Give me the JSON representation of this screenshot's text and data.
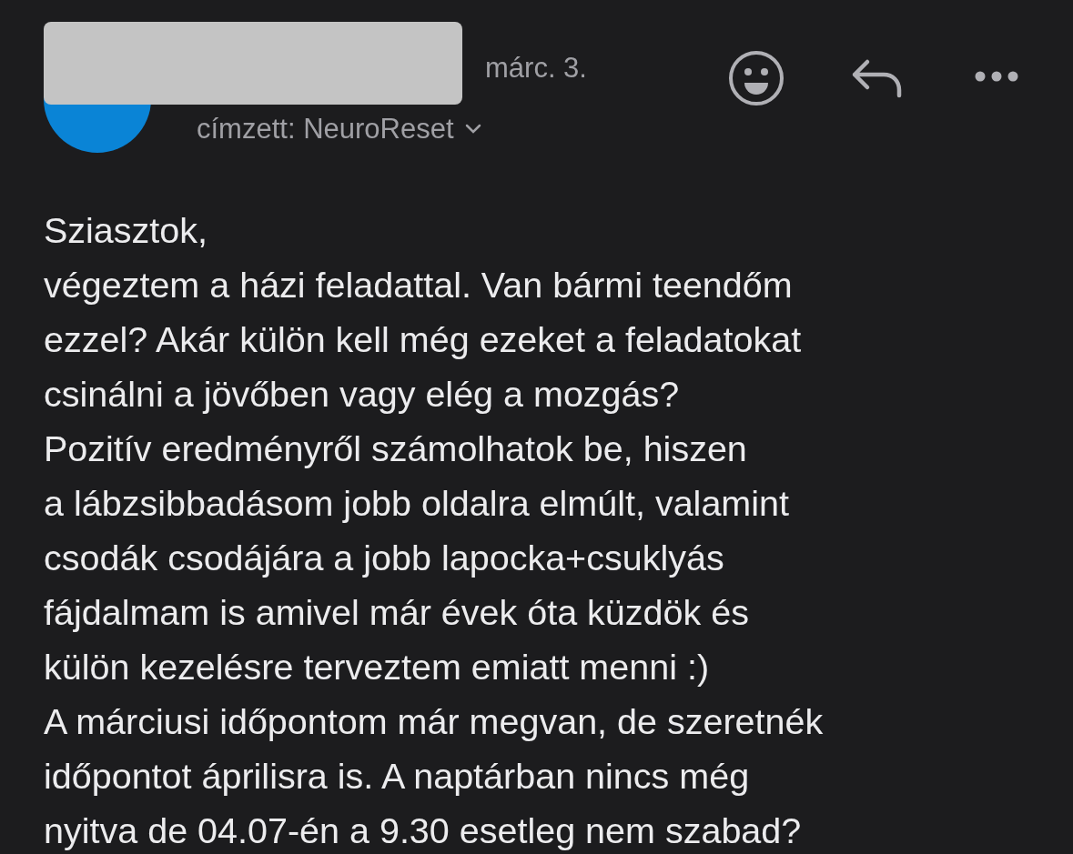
{
  "header": {
    "date": "márc. 3.",
    "recipient": "címzett: NeuroReset"
  },
  "body": {
    "lines": [
      "Sziasztok,",
      "végeztem a házi feladattal. Van bármi teendőm",
      "ezzel? Akár külön kell még ezeket a feladatokat",
      "csinálni a jövőben vagy elég a mozgás?",
      "Pozitív eredményről számolhatok be, hiszen",
      "a lábzsibbadásom jobb oldalra elmúlt, valamint",
      "csodák csodájára a jobb lapocka+csuklyás",
      "fájdalmam is amivel már évek óta küzdök és",
      "külön kezelésre terveztem emiatt menni :)",
      "A márciusi időpontom már megvan, de szeretnék",
      "időpontot áprilisra is. A naptárban nincs még",
      "nyitva de 04.07-én a 9.30 esetleg nem szabad?"
    ]
  }
}
